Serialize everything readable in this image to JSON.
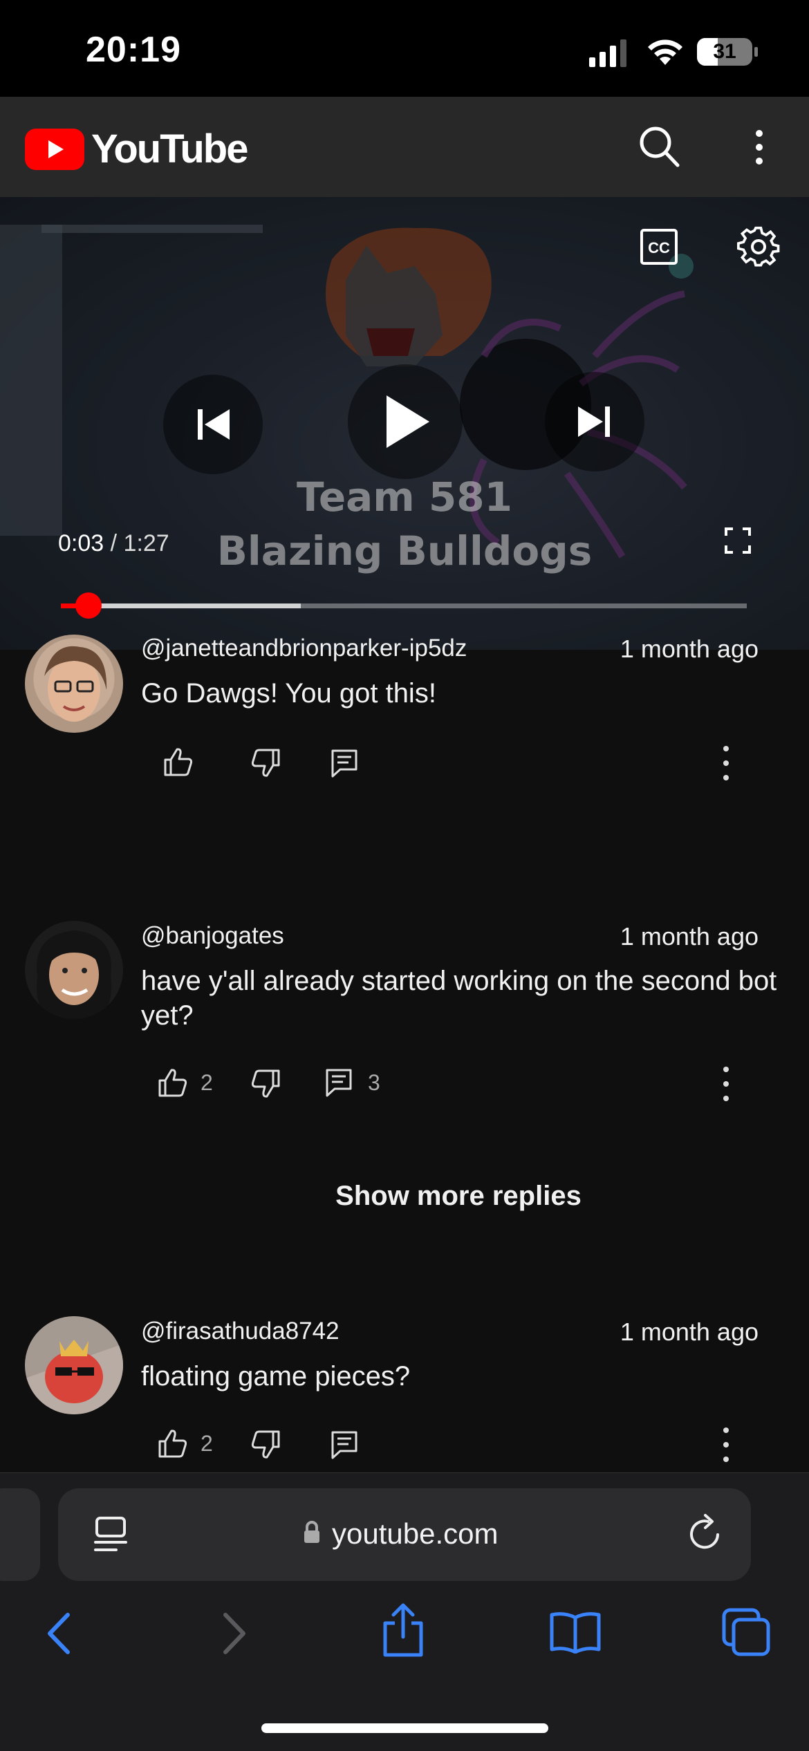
{
  "status_bar": {
    "time": "20:19",
    "battery": "31"
  },
  "header": {
    "logo_text": "YouTube",
    "icons": [
      "search-icon",
      "more-vert-icon"
    ]
  },
  "player": {
    "caption_line1": "Team 581",
    "caption_line2": "Blazing Bulldogs",
    "current_time": "0:03",
    "separator": "/",
    "duration": "1:27",
    "progress_played_fraction": 0.04,
    "progress_buffered_fraction": 0.35,
    "icons": [
      "cc-icon",
      "settings-icon",
      "previous-icon",
      "play-icon",
      "next-icon",
      "fullscreen-icon"
    ]
  },
  "comments": [
    {
      "author": "@janetteandbrionparker-ip5dz",
      "time": "1 month ago",
      "text": "Go Dawgs! You got this!",
      "likes": "",
      "replies": ""
    },
    {
      "author": "@banjogates",
      "time": "1 month ago",
      "text": "have y'all already started working on the second bot yet?",
      "likes": "2",
      "replies": "3"
    },
    {
      "author": "@firasathuda8742",
      "time": "1 month ago",
      "text": "floating game pieces?",
      "likes": "2",
      "replies": ""
    }
  ],
  "show_more_replies": "Show more replies",
  "safari": {
    "url": "youtube.com",
    "toolbar_icons": [
      "back-icon",
      "forward-icon",
      "share-icon",
      "bookmarks-icon",
      "tabs-icon"
    ],
    "accent_color": "#3a82f7"
  }
}
